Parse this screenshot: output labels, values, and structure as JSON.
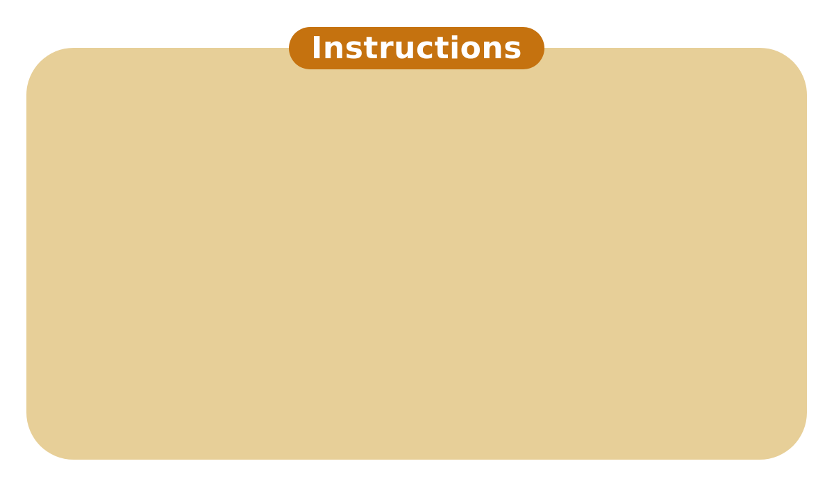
{
  "title": "Instructions",
  "colors": {
    "panel_background": "#e7cf98",
    "title_background": "#c5720f",
    "title_text": "#ffffff",
    "page_background": "#ffffff"
  }
}
